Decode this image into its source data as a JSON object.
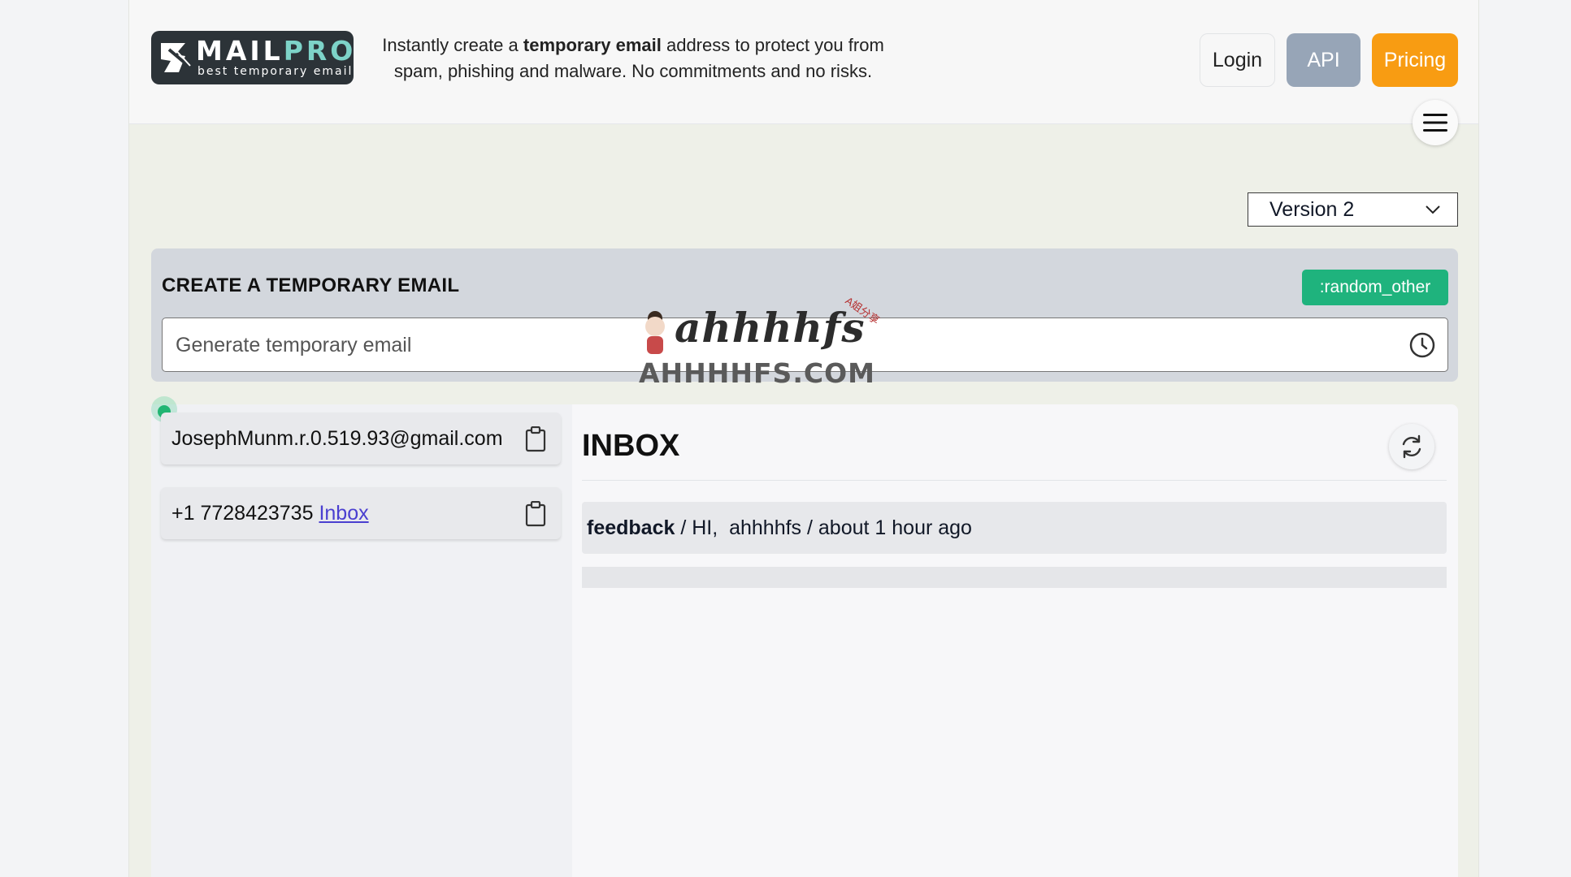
{
  "header": {
    "logo": {
      "text_main": "MAIL",
      "text_accent": "PRO",
      "subtitle": "best temporary email"
    },
    "tagline": {
      "before": "Instantly create a ",
      "bold": "temporary email",
      "after": " address to protect you from spam, phishing and malware. No commitments and no risks."
    },
    "buttons": {
      "login": "Login",
      "api": "API",
      "pricing": "Pricing"
    },
    "menu_icon": "hamburger-icon"
  },
  "version_select": {
    "value": "Version 2"
  },
  "create": {
    "title": "CREATE A TEMPORARY EMAIL",
    "random_button": ":random_other",
    "input_placeholder": "Generate temporary email",
    "input_value": "",
    "history_icon": "clock-icon"
  },
  "watermark": {
    "script": "ahhhhfs",
    "small": "A姐分享",
    "url": "AHHHHFS.COM"
  },
  "sidebar": {
    "email": "JosephMunm.r.0.519.93@gmail.com",
    "phone": "+1 7728423735",
    "phone_link": "Inbox"
  },
  "inbox": {
    "title": "INBOX",
    "messages": [
      {
        "sender": "feedback",
        "subject": "HI,",
        "from_name": "ahhhhfs",
        "time": "about 1 hour ago"
      }
    ]
  },
  "colors": {
    "api": "#97a5b7",
    "pricing": "#f89c12",
    "random": "#1fb37d",
    "status": "#22b573",
    "link": "#4a3fd0"
  }
}
